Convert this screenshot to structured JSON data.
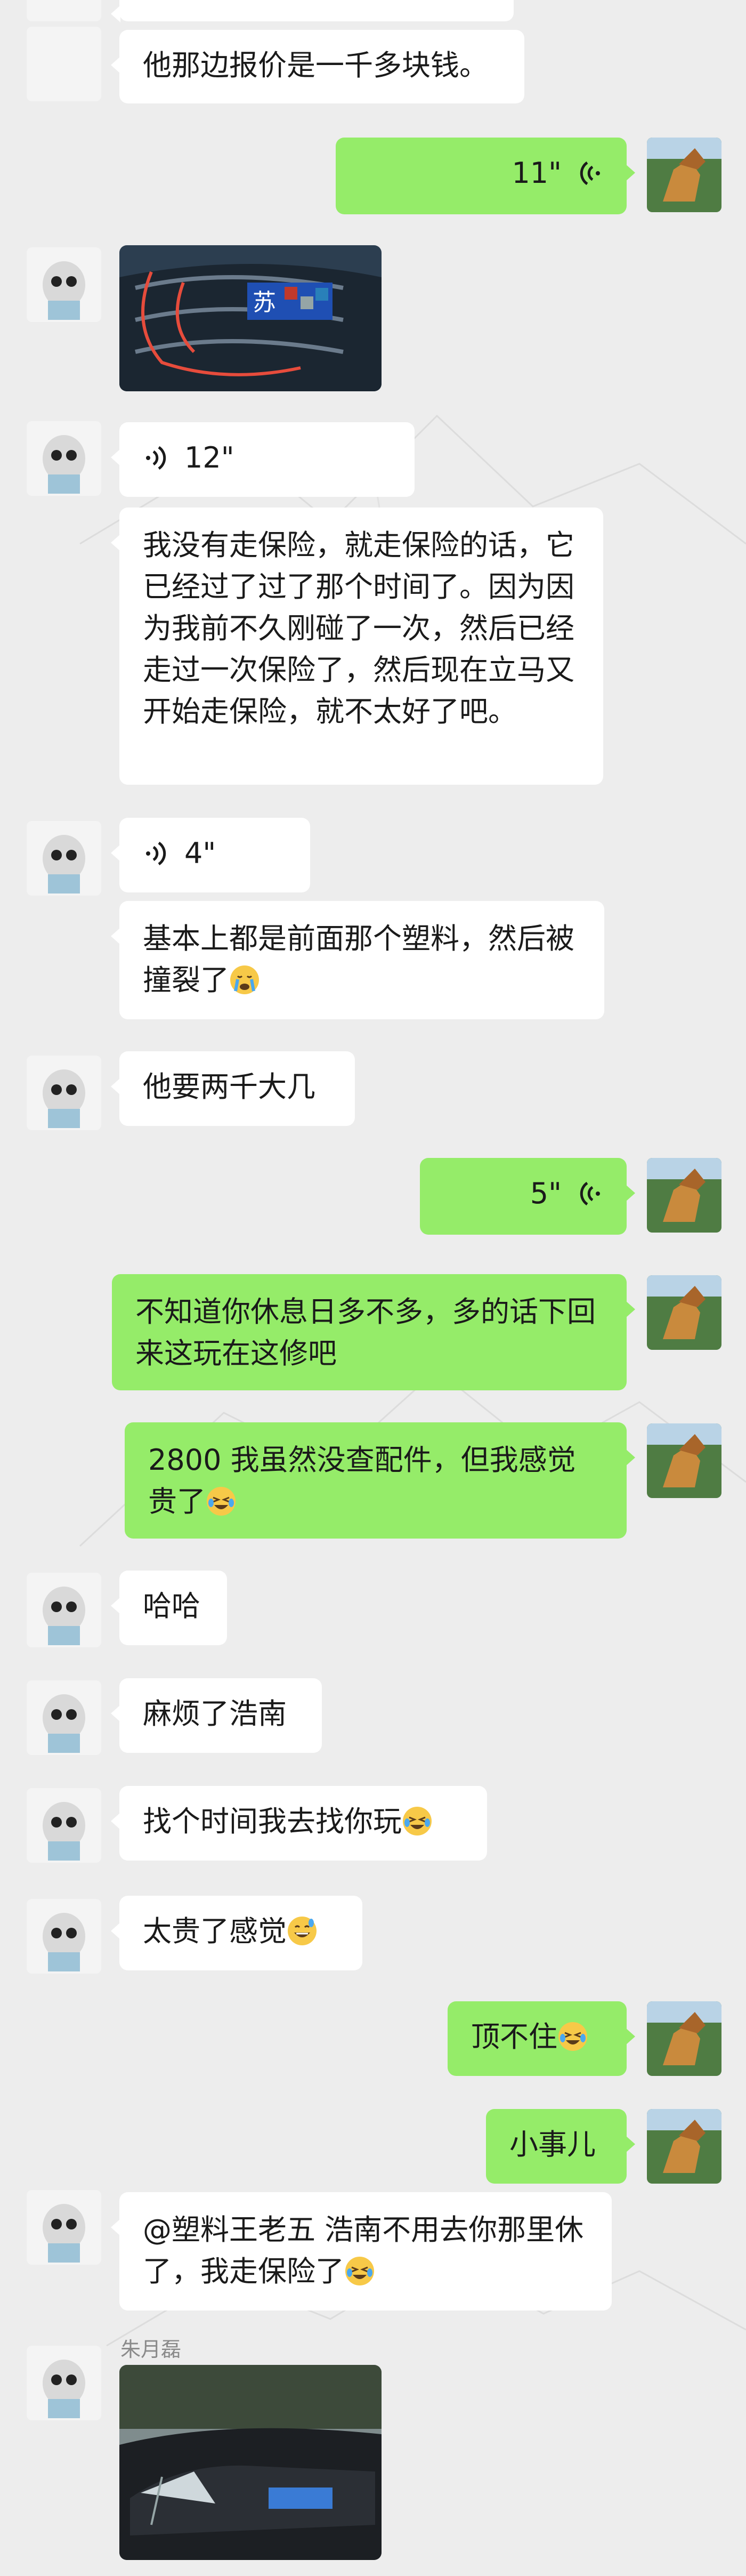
{
  "messages": [
    {
      "side": "in",
      "kind": "text",
      "text": "他那边报价是一千多块钱。"
    },
    {
      "side": "out",
      "kind": "voice",
      "duration": "11\""
    },
    {
      "side": "in",
      "kind": "image",
      "desc": "car-grille-photo"
    },
    {
      "side": "in",
      "kind": "voice",
      "duration": "12\""
    },
    {
      "side": "in",
      "kind": "text",
      "text": "我没有走保险，就走保险的话，它已经过了过了那个时间了。因为因为我前不久刚碰了一次，然后已经走过一次保险了，然后现在立马又开始走保险，就不太好了吧。"
    },
    {
      "side": "in",
      "kind": "voice",
      "duration": "4\""
    },
    {
      "side": "in",
      "kind": "text",
      "text": "基本上都是前面那个塑料，然后被撞裂了",
      "emoji": "crying-face"
    },
    {
      "side": "in",
      "kind": "text",
      "text": "他要两千大几"
    },
    {
      "side": "out",
      "kind": "voice",
      "duration": "5\""
    },
    {
      "side": "out",
      "kind": "text",
      "text": "不知道你休息日多不多，多的话下回来这玩在这修吧"
    },
    {
      "side": "out",
      "kind": "text",
      "text": "2800 我虽然没查配件，但我感觉贵了",
      "emoji": "laugh-cry-face"
    },
    {
      "side": "in",
      "kind": "text",
      "text": "哈哈"
    },
    {
      "side": "in",
      "kind": "text",
      "text": "麻烦了浩南"
    },
    {
      "side": "in",
      "kind": "text",
      "text": "找个时间我去找你玩",
      "emoji": "laugh-cry-face"
    },
    {
      "side": "in",
      "kind": "text",
      "text": "太贵了感觉",
      "emoji": "grinning-sweat-face"
    },
    {
      "side": "out",
      "kind": "text",
      "text": "顶不住",
      "emoji": "laugh-cry-face"
    },
    {
      "side": "out",
      "kind": "text",
      "text": "小事儿"
    },
    {
      "side": "in",
      "kind": "text",
      "text": "@塑料王老五 浩南不用去你那里休了，我走保险了",
      "emoji": "laugh-cry-face"
    },
    {
      "side": "in",
      "kind": "image",
      "sender": "朱月磊",
      "desc": "damaged-car-photo"
    }
  ],
  "plate_text": "苏",
  "colors": {
    "background": "#ededed",
    "incoming": "#ffffff",
    "outgoing": "#95ec69",
    "text": "#1a1a1a"
  }
}
